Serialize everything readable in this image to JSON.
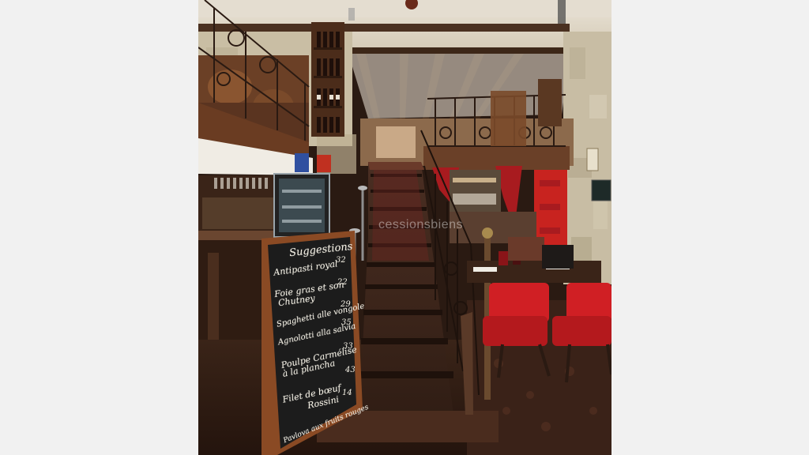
{
  "watermark": "cessionsbiens",
  "chalkboard": {
    "title": "Suggestions",
    "items": [
      {
        "name": "Antipasti royal",
        "price": "32"
      },
      {
        "name": "Foie gras et son",
        "price": "22"
      },
      {
        "name": "Chutney",
        "price": ""
      },
      {
        "name": "Spaghetti alle vongole",
        "price": "29"
      },
      {
        "name": "Agnolotti alla salvia",
        "price": "35"
      },
      {
        "name": "Poulpe Carmélise",
        "price": "33"
      },
      {
        "name": "à la plancha",
        "price": ""
      },
      {
        "name": "Filet de bœuf",
        "price": "43"
      },
      {
        "name": "Rossini",
        "price": ""
      },
      {
        "name": "Pavlova aux fruits rouges",
        "price": "14"
      }
    ]
  },
  "colors": {
    "chair_red": "#d01f24",
    "curtain_red": "#a81b1f",
    "wood_dark": "#3a2216",
    "stone": "#c8bda4"
  }
}
